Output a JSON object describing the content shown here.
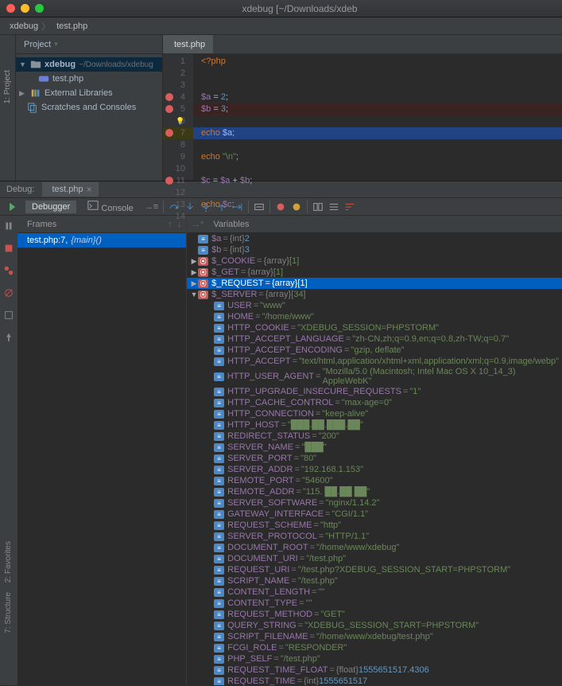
{
  "window_title": "xdebug [~/Downloads/xdeb",
  "breadcrumb": {
    "project": "xdebug",
    "file": "test.php"
  },
  "project_tool": {
    "label": "Project",
    "root": "xdebug",
    "root_path": "~/Downloads/xdebug",
    "file": "test.php",
    "ext_lib": "External Libraries",
    "scratches": "Scratches and Consoles"
  },
  "left_tab": "1: Project",
  "editor": {
    "tab": "test.php",
    "lines": [
      {
        "n": 1,
        "html": "<span class='kw'>&lt;?php</span>"
      },
      {
        "n": 2,
        "html": ""
      },
      {
        "n": 3,
        "html": ""
      },
      {
        "n": 4,
        "html": "<span class='var'>$a</span> <span class='op'>=</span> <span class='num'>2</span>;",
        "bp": true
      },
      {
        "n": 5,
        "html": "<span class='var'>$b</span> <span class='op'>=</span> <span class='num'>3</span>;",
        "bp": true,
        "err": true
      },
      {
        "n": 6,
        "html": "",
        "bulb": true
      },
      {
        "n": 7,
        "html": "<span class='kw'>echo</span> <span class='sel-var'>$a</span>;",
        "bp": true,
        "cur": true
      },
      {
        "n": 8,
        "html": ""
      },
      {
        "n": 9,
        "html": "<span class='kw'>echo</span> <span class='str'>\"\\n\"</span>;"
      },
      {
        "n": 10,
        "html": ""
      },
      {
        "n": 11,
        "html": "<span class='var'>$c</span> <span class='op'>=</span> <span class='var'>$a</span> <span class='op'>+</span> <span class='var'>$b</span>;",
        "bp": true
      },
      {
        "n": 12,
        "html": ""
      },
      {
        "n": 13,
        "html": "<span class='kw'>echo</span> <span class='var'>$c</span>;"
      },
      {
        "n": 14,
        "html": ""
      }
    ]
  },
  "debug": {
    "label": "Debug:",
    "session": "test.php",
    "debugger_tab": "Debugger",
    "console_tab": "Console",
    "frames_label": "Frames",
    "variables_label": "Variables",
    "frame_text": "test.php:7,",
    "frame_fn": " {main}()",
    "vars": [
      {
        "lvl": 0,
        "chip": "s",
        "name": "$a",
        "type": "{int}",
        "val": "2",
        "valn": true
      },
      {
        "lvl": 0,
        "chip": "s",
        "name": "$b",
        "type": "{int}",
        "val": "3",
        "valn": true
      },
      {
        "lvl": 0,
        "chip": "o",
        "arw": "▶",
        "name": "$_COOKIE",
        "type": "{array}",
        "val": "[1]"
      },
      {
        "lvl": 0,
        "chip": "o",
        "arw": "▶",
        "name": "$_GET",
        "type": "{array}",
        "val": "[1]"
      },
      {
        "lvl": 0,
        "chip": "o",
        "arw": "▶",
        "name": "$_REQUEST",
        "type": "{array}",
        "val": "[1]",
        "sel": true
      },
      {
        "lvl": 0,
        "chip": "o",
        "arw": "▼",
        "name": "$_SERVER",
        "type": "{array}",
        "val": "[34]"
      },
      {
        "lvl": 1,
        "chip": "s",
        "name": "USER",
        "val": "\"www\""
      },
      {
        "lvl": 1,
        "chip": "s",
        "name": "HOME",
        "val": "\"/home/www\""
      },
      {
        "lvl": 1,
        "chip": "s",
        "name": "HTTP_COOKIE",
        "val": "\"XDEBUG_SESSION=PHPSTORM\""
      },
      {
        "lvl": 1,
        "chip": "s",
        "name": "HTTP_ACCEPT_LANGUAGE",
        "val": "\"zh-CN,zh;q=0.9,en;q=0.8,zh-TW;q=0.7\""
      },
      {
        "lvl": 1,
        "chip": "s",
        "name": "HTTP_ACCEPT_ENCODING",
        "val": "\"gzip, deflate\""
      },
      {
        "lvl": 1,
        "chip": "s",
        "name": "HTTP_ACCEPT",
        "val": "\"text/html,application/xhtml+xml,application/xml;q=0.9,image/webp\""
      },
      {
        "lvl": 1,
        "chip": "s",
        "name": "HTTP_USER_AGENT",
        "val": "\"Mozilla/5.0 (Macintosh; Intel Mac OS X 10_14_3) AppleWebK\""
      },
      {
        "lvl": 1,
        "chip": "s",
        "name": "HTTP_UPGRADE_INSECURE_REQUESTS",
        "val": "\"1\""
      },
      {
        "lvl": 1,
        "chip": "s",
        "name": "HTTP_CACHE_CONTROL",
        "val": "\"max-age=0\""
      },
      {
        "lvl": 1,
        "chip": "s",
        "name": "HTTP_CONNECTION",
        "val": "\"keep-alive\""
      },
      {
        "lvl": 1,
        "chip": "s",
        "name": "HTTP_HOST",
        "val": "\"███.██.███.██\""
      },
      {
        "lvl": 1,
        "chip": "s",
        "name": "REDIRECT_STATUS",
        "val": "\"200\""
      },
      {
        "lvl": 1,
        "chip": "s",
        "name": "SERVER_NAME",
        "val": "\"███\""
      },
      {
        "lvl": 1,
        "chip": "s",
        "name": "SERVER_PORT",
        "val": "\"80\""
      },
      {
        "lvl": 1,
        "chip": "s",
        "name": "SERVER_ADDR",
        "val": "\"192.168.1.153\""
      },
      {
        "lvl": 1,
        "chip": "s",
        "name": "REMOTE_PORT",
        "val": "\"54600\""
      },
      {
        "lvl": 1,
        "chip": "s",
        "name": "REMOTE_ADDR",
        "val": "\"115.   ██.██    ██\""
      },
      {
        "lvl": 1,
        "chip": "s",
        "name": "SERVER_SOFTWARE",
        "val": "\"nginx/1.14.2\""
      },
      {
        "lvl": 1,
        "chip": "s",
        "name": "GATEWAY_INTERFACE",
        "val": "\"CGI/1.1\""
      },
      {
        "lvl": 1,
        "chip": "s",
        "name": "REQUEST_SCHEME",
        "val": "\"http\""
      },
      {
        "lvl": 1,
        "chip": "s",
        "name": "SERVER_PROTOCOL",
        "val": "\"HTTP/1.1\""
      },
      {
        "lvl": 1,
        "chip": "s",
        "name": "DOCUMENT_ROOT",
        "val": "\"/home/www/xdebug\""
      },
      {
        "lvl": 1,
        "chip": "s",
        "name": "DOCUMENT_URI",
        "val": "\"/test.php\""
      },
      {
        "lvl": 1,
        "chip": "s",
        "name": "REQUEST_URI",
        "val": "\"/test.php?XDEBUG_SESSION_START=PHPSTORM\""
      },
      {
        "lvl": 1,
        "chip": "s",
        "name": "SCRIPT_NAME",
        "val": "\"/test.php\""
      },
      {
        "lvl": 1,
        "chip": "s",
        "name": "CONTENT_LENGTH",
        "val": "\"\""
      },
      {
        "lvl": 1,
        "chip": "s",
        "name": "CONTENT_TYPE",
        "val": "\"\""
      },
      {
        "lvl": 1,
        "chip": "s",
        "name": "REQUEST_METHOD",
        "val": "\"GET\""
      },
      {
        "lvl": 1,
        "chip": "s",
        "name": "QUERY_STRING",
        "val": "\"XDEBUG_SESSION_START=PHPSTORM\""
      },
      {
        "lvl": 1,
        "chip": "s",
        "name": "SCRIPT_FILENAME",
        "val": "\"/home/www/xdebug/test.php\""
      },
      {
        "lvl": 1,
        "chip": "s",
        "name": "FCGI_ROLE",
        "val": "\"RESPONDER\""
      },
      {
        "lvl": 1,
        "chip": "s",
        "name": "PHP_SELF",
        "val": "\"/test.php\""
      },
      {
        "lvl": 1,
        "chip": "s",
        "name": "REQUEST_TIME_FLOAT",
        "type": "{float}",
        "val": "1555651517.4306",
        "valn": true
      },
      {
        "lvl": 1,
        "chip": "s",
        "name": "REQUEST_TIME",
        "type": "{int}",
        "val": "1555651517",
        "valn": true
      }
    ]
  },
  "side_tabs": {
    "fav": "2: Favorites",
    "struct": "7: Structure"
  }
}
